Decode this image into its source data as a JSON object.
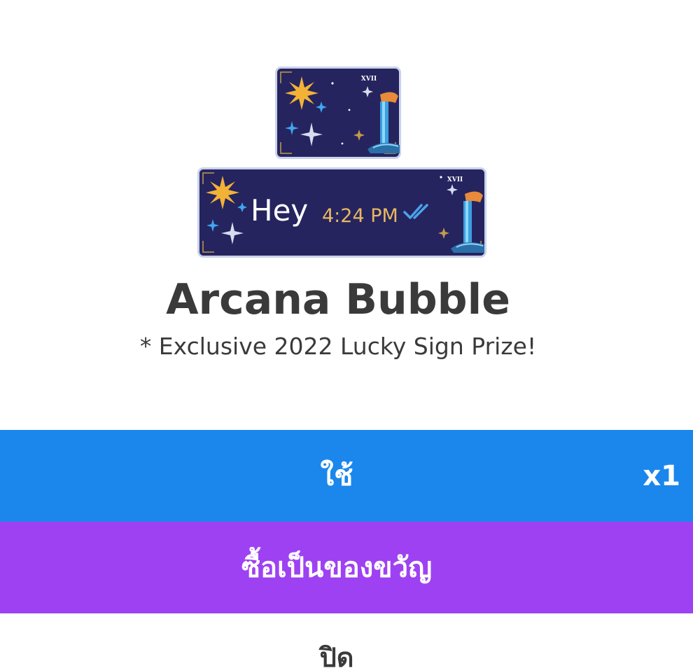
{
  "item": {
    "title": "Arcana Bubble",
    "subtitle": "* Exclusive 2022 Lucky Sign Prize!",
    "preview": {
      "message_text": "Hey",
      "message_time": "4:24 PM",
      "card_numeral": "XVII"
    }
  },
  "actions": {
    "use_label": "ใช้",
    "quantity": "x1",
    "gift_label": "ซื้อเป็นของขวัญ",
    "close_label": "ปิด"
  },
  "colors": {
    "use_button": "#1b87ec",
    "gift_button": "#9e41f2",
    "text_dark": "#3a3a3a",
    "bubble_background": "#25245f",
    "bubble_border": "#c9d2ea",
    "gold": "#f2b236",
    "time_text": "#e8b860",
    "check_marks": "#4aa3e8"
  }
}
